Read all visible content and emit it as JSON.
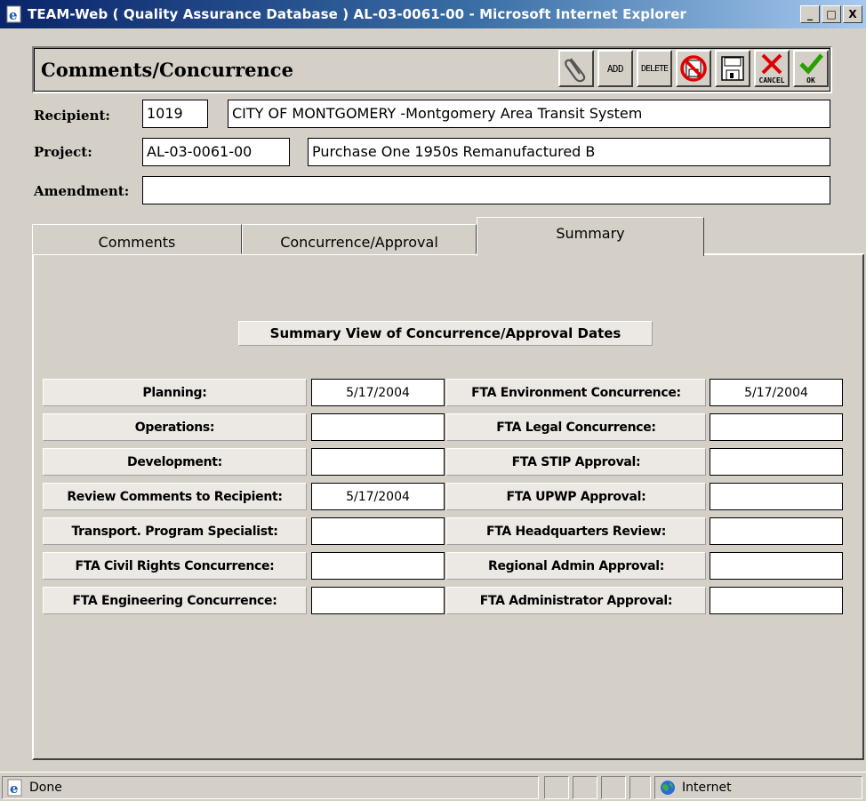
{
  "window": {
    "title": "TEAM-Web ( Quality Assurance Database ) AL-03-0061-00 - Microsoft Internet Explorer",
    "minimize": "_",
    "maximize": "□",
    "close": "X"
  },
  "header": {
    "title": "Comments/Concurrence",
    "toolbar": {
      "attach_icon": "paperclip-icon",
      "add_label": "ADD",
      "delete_label": "DELETE",
      "cancel_label": "CANCEL",
      "ok_label": "OK"
    }
  },
  "form": {
    "recipient_label": "Recipient:",
    "recipient_id": "1019",
    "recipient_name": "CITY OF MONTGOMERY -Montgomery Area Transit System",
    "project_label": "Project:",
    "project_id": "AL-03-0061-00",
    "project_name": "Purchase One 1950s Remanufactured B",
    "amendment_label": "Amendment:",
    "amendment_value": ""
  },
  "tabs": [
    {
      "label": "Comments"
    },
    {
      "label": "Concurrence/Approval"
    },
    {
      "label": "Summary"
    }
  ],
  "summary": {
    "heading": "Summary View of Concurrence/Approval Dates",
    "left": [
      {
        "label": "Planning:",
        "value": "5/17/2004"
      },
      {
        "label": "Operations:",
        "value": ""
      },
      {
        "label": "Development:",
        "value": ""
      },
      {
        "label": "Review Comments to Recipient:",
        "value": "5/17/2004"
      },
      {
        "label": "Transport. Program Specialist:",
        "value": ""
      },
      {
        "label": "FTA Civil Rights Concurrence:",
        "value": ""
      },
      {
        "label": "FTA Engineering Concurrence:",
        "value": ""
      }
    ],
    "right": [
      {
        "label": "FTA Environment Concurrence:",
        "value": "5/17/2004"
      },
      {
        "label": "FTA Legal Concurrence:",
        "value": ""
      },
      {
        "label": "FTA STIP Approval:",
        "value": ""
      },
      {
        "label": "FTA UPWP Approval:",
        "value": ""
      },
      {
        "label": "FTA Headquarters Review:",
        "value": ""
      },
      {
        "label": "Regional Admin Approval:",
        "value": ""
      },
      {
        "label": "FTA Administrator Approval:",
        "value": ""
      }
    ]
  },
  "status": {
    "text": "Done",
    "zone": "Internet"
  }
}
